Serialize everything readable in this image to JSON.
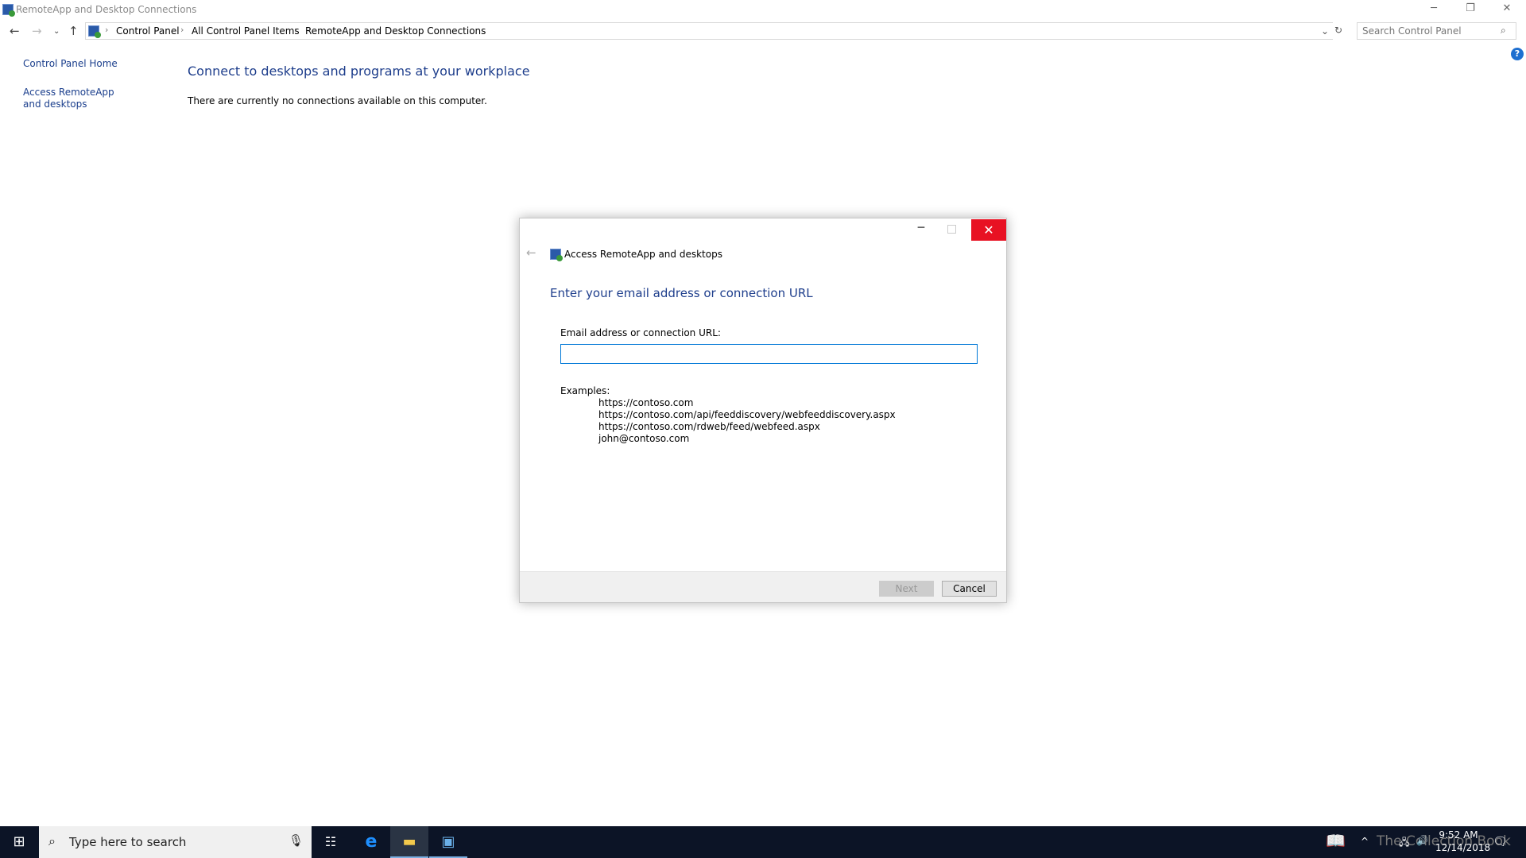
{
  "window": {
    "title": "RemoteApp and Desktop Connections",
    "minimize": "─",
    "restore": "❐",
    "close": "✕"
  },
  "address": {
    "crumbs": [
      "Control Panel",
      "All Control Panel Items",
      "RemoteApp and Desktop Connections"
    ],
    "search_placeholder": "Search Control Panel"
  },
  "sidebar": {
    "items": [
      {
        "label": "Control Panel Home"
      },
      {
        "label": "Access RemoteApp and desktops"
      }
    ]
  },
  "main": {
    "heading": "Connect to desktops and programs at your workplace",
    "message": "There are currently no connections available on this computer."
  },
  "dialog": {
    "title": "Access RemoteApp and desktops",
    "heading": "Enter your email address or connection URL",
    "field_label": "Email address or connection URL:",
    "field_value": "",
    "examples_label": "Examples:",
    "examples": [
      "https://contoso.com",
      "https://contoso.com/api/feeddiscovery/webfeeddiscovery.aspx",
      "https://contoso.com/rdweb/feed/webfeed.aspx",
      "john@contoso.com"
    ],
    "next_label": "Next",
    "cancel_label": "Cancel",
    "next_enabled": false
  },
  "taskbar": {
    "search_placeholder": "Type here to search",
    "time": "9:52 AM",
    "date": "12/14/2018",
    "watermark": "The Collection Book"
  },
  "colors": {
    "accent": "#1e3e8c",
    "close": "#e81123",
    "taskbar": "#0c1426",
    "focus": "#0078d7"
  }
}
